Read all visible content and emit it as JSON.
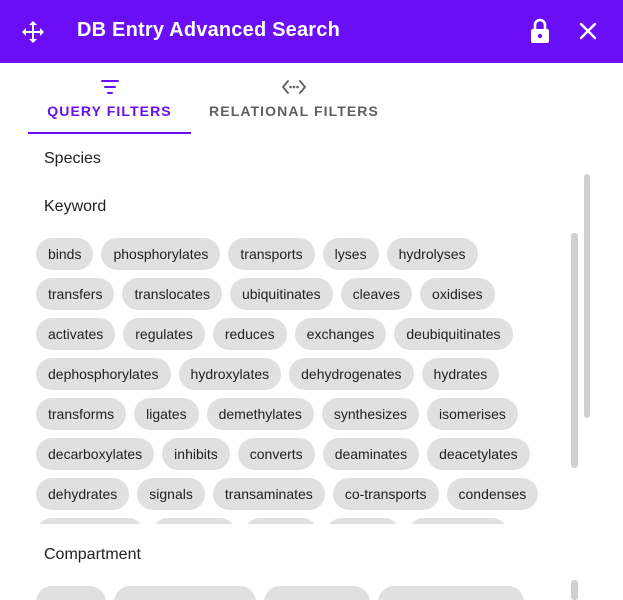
{
  "header": {
    "title": "DB Entry Advanced Search",
    "move_icon": "move-icon",
    "lock_icon": "lock-icon",
    "close_icon": "close-icon",
    "background_color": "#6a0ef5"
  },
  "tabs": [
    {
      "label": "QUERY FILTERS",
      "icon": "filter-icon",
      "active": true
    },
    {
      "label": "RELATIONAL FILTERS",
      "icon": "code-dots-icon",
      "active": false
    }
  ],
  "sections": {
    "species_label": "Species",
    "keyword_label": "Keyword",
    "compartment_label": "Compartment"
  },
  "keyword_chips": [
    [
      "binds",
      "phosphorylates",
      "transports",
      "lyses",
      "hydrolyses"
    ],
    [
      "transfers",
      "translocates",
      "ubiquitinates",
      "cleaves",
      "oxidises"
    ],
    [
      "activates",
      "regulates",
      "reduces",
      "exchanges",
      "deubiquitinates"
    ],
    [
      "dephosphorylates",
      "hydroxylates",
      "dehydrogenates",
      "hydrates"
    ],
    [
      "transforms",
      "ligates",
      "demethylates",
      "synthesizes",
      "isomerises"
    ],
    [
      "decarboxylates",
      "inhibits",
      "converts",
      "deaminates",
      "deacetylates"
    ],
    [
      "dehydrates",
      "signals",
      "transaminates",
      "co-transports",
      "condenses"
    ]
  ],
  "accent_color": "#6a0ef5",
  "chip_color": "#e0e0e0"
}
